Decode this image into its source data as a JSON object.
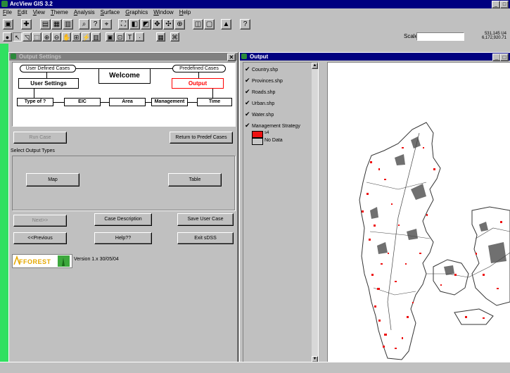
{
  "app": {
    "title": "ArcView GIS 3.2"
  },
  "menu": [
    "File",
    "Edit",
    "View",
    "Theme",
    "Analysis",
    "Surface",
    "Graphics",
    "Window",
    "Help"
  ],
  "toolbar": {
    "scale_label": "Scale 1:",
    "scale_value": "",
    "coords": [
      "531,145 U4",
      "6,172,920.71"
    ]
  },
  "settings_window": {
    "title": "Output Settings",
    "flow": {
      "user_defined": "User Defined Cases",
      "welcome": "Welcome",
      "predefined": "Predefined Cases",
      "user_settings": "User Settings",
      "output": "Output",
      "type_of": "Type of ?",
      "eic": "EIC",
      "area": "Area",
      "management": "Management",
      "time": "Time"
    },
    "buttons": {
      "run_case": "Run Case",
      "return_predef": "Return to Predef Cases",
      "map": "Map",
      "table": "Table",
      "next": "Next>>",
      "case_description": "Case Description",
      "save_user_case": "Save User Case",
      "previous": "<<Previous",
      "help": "Help??",
      "exit": "Exit sDSS"
    },
    "output_types_label": "Select Output Types",
    "logo_text": "AFFOREST",
    "version": "Version 1.x   30/05/04"
  },
  "output_window": {
    "title": "Output",
    "layers": [
      {
        "name": "Country.shp",
        "checked": true
      },
      {
        "name": "Provinces.shp",
        "checked": true
      },
      {
        "name": "Roads.shp",
        "checked": true
      },
      {
        "name": "Urban.shp",
        "checked": true
      },
      {
        "name": "Water.shp",
        "checked": true
      },
      {
        "name": "Management Strategy",
        "checked": true
      }
    ],
    "legend_classes": [
      {
        "label": "s4",
        "color": "#ee1111"
      },
      {
        "label": "No Data",
        "color": "#c8c8c8"
      }
    ]
  },
  "colors": {
    "accent_title": "#000080",
    "output_red": "#ff0000",
    "desktop_stripe": "#30e060",
    "urban": "#707070"
  }
}
